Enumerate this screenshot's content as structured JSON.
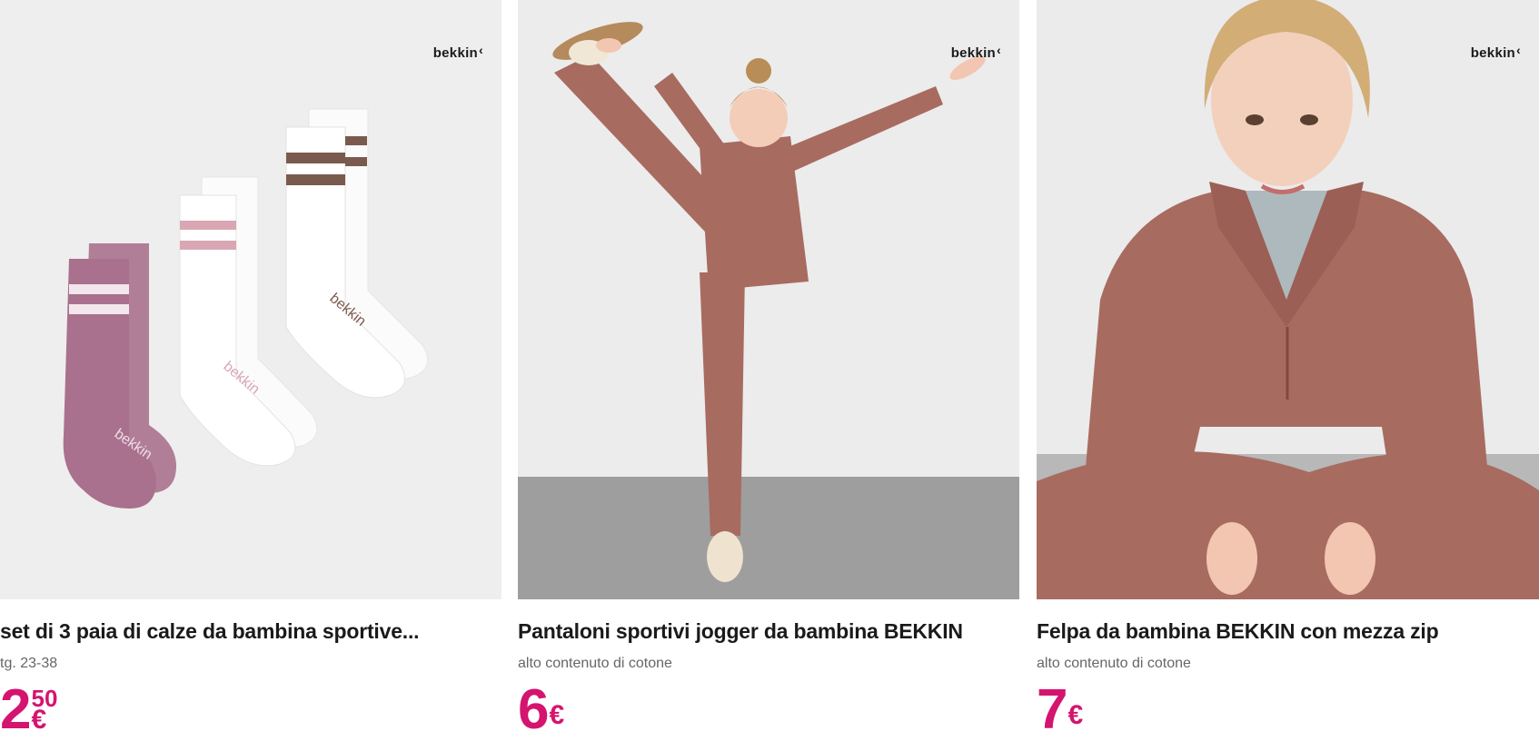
{
  "products": [
    {
      "brand": "bekkin",
      "title": "set di 3 paia di calze da bambina sportive...",
      "subtitle": "tg. 23-38",
      "price_int": "2",
      "price_dec": "50",
      "currency": "€",
      "image_desc_icon": "socks-image"
    },
    {
      "brand": "bekkin",
      "title": "Pantaloni sportivi jogger da bambina BEKKIN",
      "subtitle": "alto contenuto di cotone",
      "price_int": "6",
      "price_dec": "",
      "currency": "€",
      "image_desc_icon": "girl-stretching-image"
    },
    {
      "brand": "bekkin",
      "title": "Felpa da bambina BEKKIN con mezza zip",
      "subtitle": "alto contenuto di cotone",
      "price_int": "7",
      "price_dec": "",
      "currency": "€",
      "image_desc_icon": "girl-sweatshirt-image"
    }
  ],
  "colors": {
    "price": "#d4146f",
    "mauve": "#a9718d",
    "rust": "#a86b60"
  }
}
